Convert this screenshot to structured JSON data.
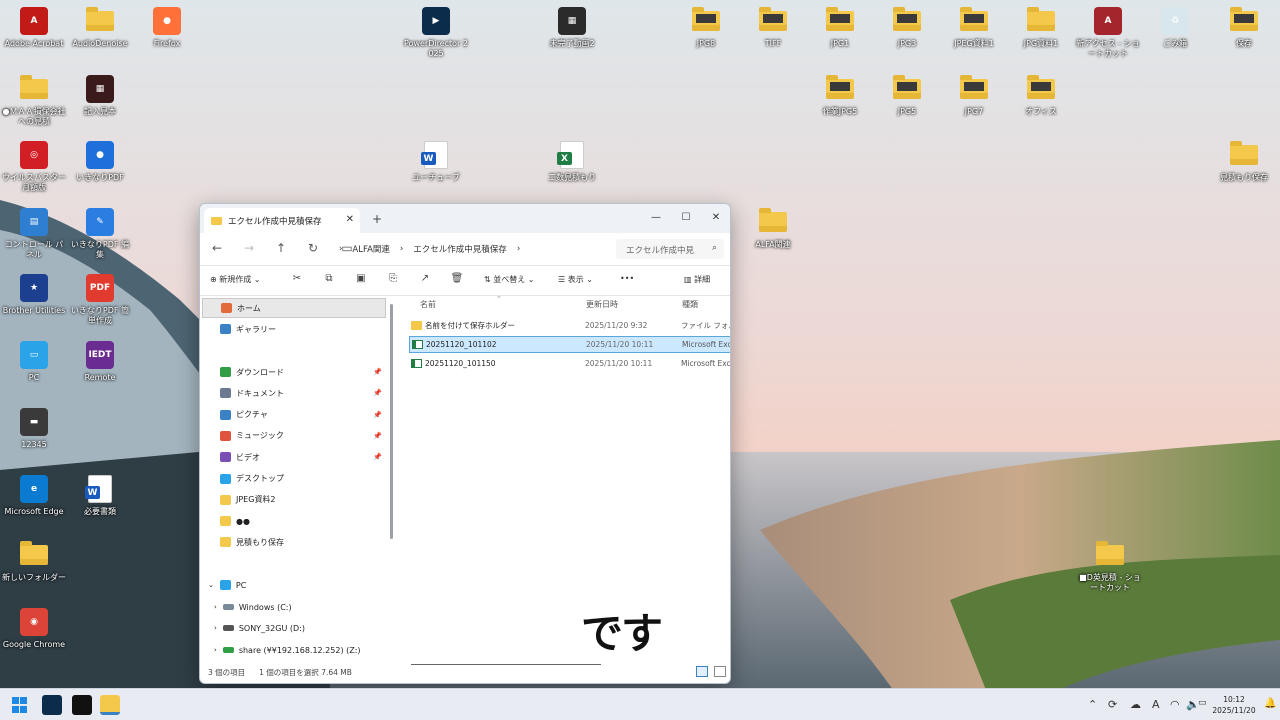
{
  "desktop": {
    "icons": [
      {
        "label": "Adobe Acrobat",
        "kind": "tile",
        "color": "#c21b17",
        "glyph": "A"
      },
      {
        "label": "AudioDenoise",
        "kind": "folder"
      },
      {
        "label": "Firefox",
        "kind": "tile",
        "color": "#ff7139",
        "glyph": "●"
      },
      {
        "label": "PowerDirector 2025",
        "kind": "tile",
        "color": "#0b2c4a",
        "glyph": "▶"
      },
      {
        "label": "未完了動画2",
        "kind": "tile",
        "color": "#2b2b2b",
        "glyph": "▦"
      },
      {
        "label": "JPG8",
        "kind": "folder-thumb"
      },
      {
        "label": "TIFF",
        "kind": "folder-thumb"
      },
      {
        "label": "JPG1",
        "kind": "folder-thumb"
      },
      {
        "label": "JPG3",
        "kind": "folder-thumb"
      },
      {
        "label": "JPEG資料1",
        "kind": "folder-thumb"
      },
      {
        "label": "JPG資料1",
        "kind": "folder"
      },
      {
        "label": "新アクセス - ショートカット",
        "kind": "tile",
        "color": "#a4262c",
        "glyph": "A"
      },
      {
        "label": "ごみ箱",
        "kind": "tile",
        "color": "#d8e6ee",
        "glyph": "♻"
      },
      {
        "label": "保存",
        "kind": "folder-thumb"
      },
      {
        "label": "●ＭＡＡ損保会社 への見積",
        "kind": "folder"
      },
      {
        "label": "記入見本",
        "kind": "tile",
        "color": "#3a1a1a",
        "glyph": "▦"
      },
      {
        "label": "作業JPG5",
        "kind": "folder-thumb"
      },
      {
        "label": "JPG5",
        "kind": "folder-thumb"
      },
      {
        "label": "JPG7",
        "kind": "folder-thumb"
      },
      {
        "label": "オフィス",
        "kind": "folder-thumb"
      },
      {
        "label": "ウイルスバスター 月額版",
        "kind": "tile",
        "color": "#d21f26",
        "glyph": "◎"
      },
      {
        "label": "いきなりPDF",
        "kind": "tile",
        "color": "#1e6fd9",
        "glyph": "●"
      },
      {
        "label": "ユーチューブ",
        "kind": "word"
      },
      {
        "label": "工数見積もり",
        "kind": "excel"
      },
      {
        "label": "見積もり保存",
        "kind": "folder"
      },
      {
        "label": "コントロール パネル",
        "kind": "tile",
        "color": "#2e7fd1",
        "glyph": "▤"
      },
      {
        "label": "いきなりPDF 編集",
        "kind": "tile",
        "color": "#2a7de1",
        "glyph": "✎"
      },
      {
        "label": "ALFA関連",
        "kind": "folder"
      },
      {
        "label": "Brother Utilities",
        "kind": "tile",
        "color": "#1c3f8f",
        "glyph": "★"
      },
      {
        "label": "いきなりPDF 簡単作成",
        "kind": "tile",
        "color": "#e03b2e",
        "glyph": "PDF"
      },
      {
        "label": "PC",
        "kind": "tile",
        "color": "#2aa3e8",
        "glyph": "▭"
      },
      {
        "label": "Remote",
        "kind": "tile",
        "color": "#6b2c91",
        "glyph": "IEDT"
      },
      {
        "label": "12345",
        "kind": "tile",
        "color": "#3a3a3a",
        "glyph": "▬"
      },
      {
        "label": "Microsoft Edge",
        "kind": "tile",
        "color": "#0b7bd1",
        "glyph": "e"
      },
      {
        "label": "必要書類",
        "kind": "word"
      },
      {
        "label": "■D英見積 - ショートカット",
        "kind": "folder"
      },
      {
        "label": "新しいフォルダー",
        "kind": "folder"
      },
      {
        "label": "Google Chrome",
        "kind": "tile",
        "color": "#db4437",
        "glyph": "◉"
      }
    ]
  },
  "explorer": {
    "tab_title": "エクセル作成中見積保存",
    "close_tab": "✕",
    "new_tab": "+",
    "window_controls": {
      "minimize": "—",
      "maximize": "☐",
      "close": "✕"
    },
    "nav_buttons": {
      "back": "←",
      "forward": "→",
      "up": "↑",
      "refresh": "↻",
      "view": "▭"
    },
    "breadcrumb": [
      "ALFA関連",
      "エクセル作成中見積保存"
    ],
    "breadcrumb_sep": "›",
    "search_placeholder": "エクセル作成中見",
    "commands": {
      "new": "新規作成",
      "sort": "並べ替え",
      "view": "表示",
      "more": "•••",
      "details": "詳細"
    },
    "sidebar": {
      "home": "ホーム",
      "gallery": "ギャラリー",
      "quick": [
        {
          "label": "ダウンロード",
          "color": "#2f9e44",
          "pinned": true
        },
        {
          "label": "ドキュメント",
          "color": "#6b7a90",
          "pinned": true
        },
        {
          "label": "ピクチャ",
          "color": "#3b82c4",
          "pinned": true
        },
        {
          "label": "ミュージック",
          "color": "#e0533d",
          "pinned": true
        },
        {
          "label": "ビデオ",
          "color": "#7a4fb5",
          "pinned": true
        },
        {
          "label": "デスクトップ",
          "color": "#2aa3e8",
          "pinned": false
        },
        {
          "label": "JPEG資料2",
          "color": "#f4c94b",
          "pinned": false
        },
        {
          "label": "●●",
          "color": "#f4c94b",
          "pinned": false
        },
        {
          "label": "見積もり保存",
          "color": "#f4c94b",
          "pinned": false
        }
      ],
      "pc": "PC",
      "drives": [
        "Windows (C:)",
        "SONY_32GU (D:)",
        "share (¥¥192.168.12.252) (Z:)"
      ]
    },
    "columns": {
      "name": "名前",
      "date": "更新日時",
      "type": "種類"
    },
    "files": [
      {
        "name": "名前を付けて保存ホルダー",
        "date": "2025/11/20 9:32",
        "type": "ファイル フォルダー",
        "icon": "folder",
        "selected": false
      },
      {
        "name": "20251120_101102",
        "date": "2025/11/20 10:11",
        "type": "Microsoft Excel",
        "icon": "excel",
        "selected": true
      },
      {
        "name": "20251120_101150",
        "date": "2025/11/20 10:11",
        "type": "Microsoft Excel",
        "icon": "excel",
        "selected": false
      }
    ],
    "status": {
      "count": "3 個の項目",
      "selection": "1 個の項目を選択  7.64 MB"
    }
  },
  "caption": "です",
  "taskbar": {
    "time": "10:12",
    "date": "2025/11/20",
    "ime": "A"
  }
}
